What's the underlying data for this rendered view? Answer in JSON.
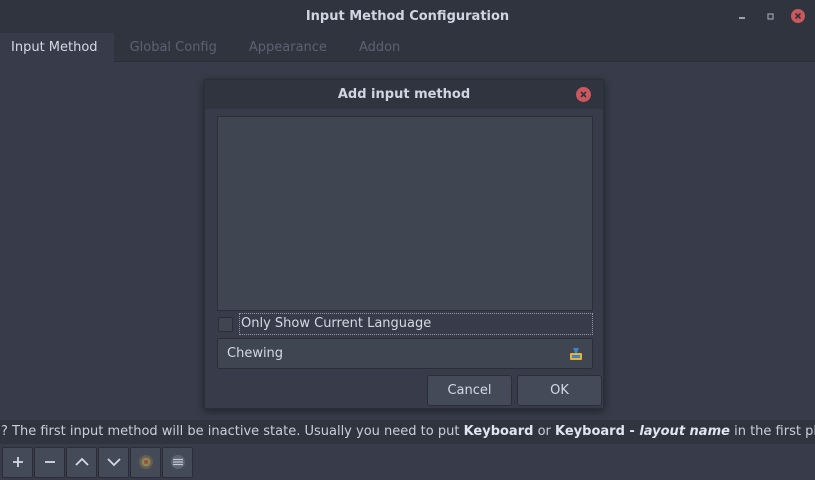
{
  "window": {
    "title": "Input Method Configuration",
    "controls": [
      "minimize-icon",
      "restore-icon",
      "close-icon"
    ]
  },
  "tabs": [
    {
      "label": "Input Method",
      "active": true
    },
    {
      "label": "Global Config",
      "active": false
    },
    {
      "label": "Appearance",
      "active": false
    },
    {
      "label": "Addon",
      "active": false
    }
  ],
  "hint": {
    "prefix": "? The first input method will be inactive state. Usually you need to put ",
    "bold1": "Keyboard",
    "middle": " or ",
    "bold2": "Keyboard - ",
    "bold2_italic": "layout name",
    "suffix": " in the first place."
  },
  "toolbar": {
    "buttons": [
      "plus-icon",
      "minus-icon",
      "chevron-up-icon",
      "chevron-down-icon",
      "configure-icon",
      "keyboard-icon"
    ]
  },
  "dialog": {
    "title": "Add input method",
    "checkbox_label": "Only Show Current Language",
    "checkbox_checked": false,
    "search_value": "Chewing",
    "cancel_label": "Cancel",
    "ok_label": "OK"
  },
  "colors": {
    "bg": "#383c4a",
    "titlebar": "#2f343f",
    "close": "#cc575d",
    "field": "#404552"
  }
}
